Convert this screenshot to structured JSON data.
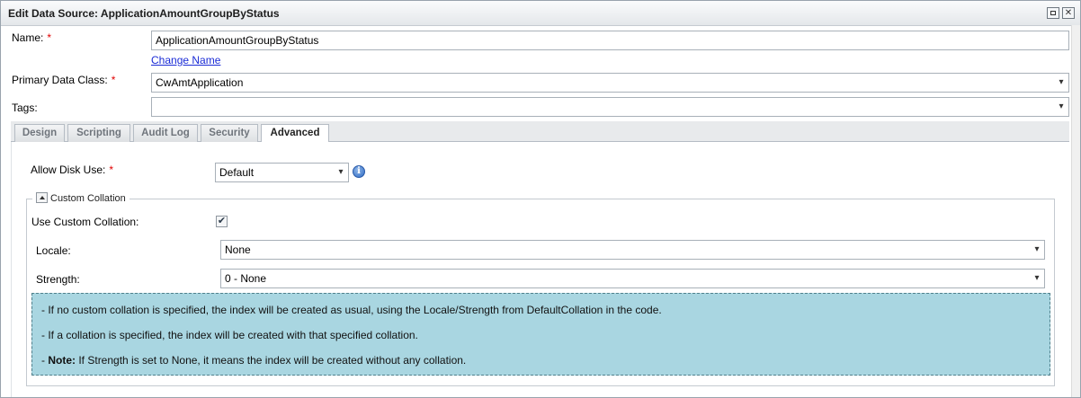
{
  "window": {
    "title": "Edit Data Source: ApplicationAmountGroupByStatus",
    "maximize_icon": "maximize-icon",
    "close_icon": "close-icon"
  },
  "form": {
    "name_label": "Name:",
    "name_value": "ApplicationAmountGroupByStatus",
    "change_name_link": "Change Name",
    "primary_class_label": "Primary Data Class:",
    "primary_class_value": "CwAmtApplication",
    "tags_label": "Tags:",
    "tags_value": "",
    "required_marker": "*"
  },
  "tabs": [
    {
      "label": "Design",
      "active": false
    },
    {
      "label": "Scripting",
      "active": false
    },
    {
      "label": "Audit Log",
      "active": false
    },
    {
      "label": "Security",
      "active": false
    },
    {
      "label": "Advanced",
      "active": true
    }
  ],
  "advanced": {
    "allow_disk_use_label": "Allow Disk Use:",
    "allow_disk_use_value": "Default",
    "info_icon": "info-icon",
    "collation_legend": "Custom Collation",
    "use_custom_collation_label": "Use Custom Collation:",
    "use_custom_collation_checked": true,
    "locale_label": "Locale:",
    "locale_value": "None",
    "strength_label": "Strength:",
    "strength_value": "0 - None",
    "notes": {
      "line1": "- If no custom collation is specified, the index will be created as usual, using the Locale/Strength from DefaultCollation in the code.",
      "line2": "- If a collation is specified, the index will be created with that specified collation.",
      "line3_prefix": "- ",
      "line3_bold": "Note:",
      "line3_rest": " If Strength is set to None, it means the index will be created without any collation."
    }
  },
  "colors": {
    "notes_background": "#a9d6e1",
    "required": "#e00000",
    "link": "#1a2bd6"
  }
}
